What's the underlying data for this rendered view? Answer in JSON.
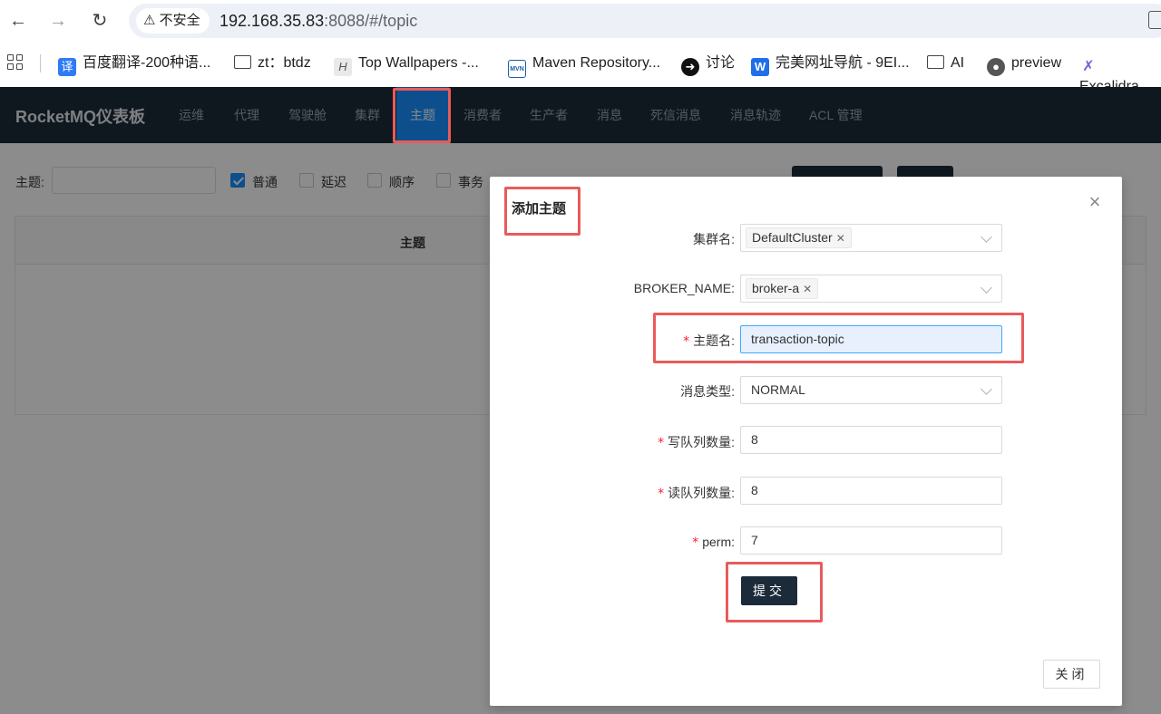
{
  "browser": {
    "security_label": "不安全",
    "url_host": "192.168.35.83",
    "url_rest": ":8088/#/topic",
    "bookmarks": [
      {
        "label": "百度翻译-200种语...",
        "icon": "translate-icon"
      },
      {
        "label": "zt：btdz",
        "icon": "folder-icon"
      },
      {
        "label": "Top Wallpapers -...",
        "icon": "wallpaper-icon"
      },
      {
        "label": "Maven Repository...",
        "icon": "maven-icon"
      },
      {
        "label": "讨论",
        "icon": "discussion-icon"
      },
      {
        "label": "完美网址导航 - 9EI...",
        "icon": "w-icon"
      },
      {
        "label": "AI",
        "icon": "folder-icon"
      },
      {
        "label": "preview",
        "icon": "globe-icon"
      },
      {
        "label": "Excalidra",
        "icon": "excalidraw-icon"
      }
    ]
  },
  "app": {
    "brand": "RocketMQ仪表板",
    "menu": [
      "运维",
      "代理",
      "驾驶舱",
      "集群",
      "主题",
      "消费者",
      "生产者",
      "消息",
      "死信消息",
      "消息轨迹",
      "ACL 管理"
    ],
    "active_menu": "主题"
  },
  "toolbar": {
    "topic_label": "主题:",
    "filters": [
      {
        "label": "普通",
        "checked": true
      },
      {
        "label": "延迟",
        "checked": false
      },
      {
        "label": "顺序",
        "checked": false
      },
      {
        "label": "事务",
        "checked": false
      }
    ]
  },
  "table": {
    "header_topic": "主题"
  },
  "modal": {
    "title": "添加主题",
    "cluster_label": "集群名:",
    "cluster_value": "DefaultCluster",
    "broker_label": "BROKER_NAME:",
    "broker_value": "broker-a",
    "topic_name_label": "主题名:",
    "topic_name_value": "transaction-topic",
    "message_type_label": "消息类型:",
    "message_type_value": "NORMAL",
    "write_queue_label": "写队列数量:",
    "write_queue_value": "8",
    "read_queue_label": "读队列数量:",
    "read_queue_value": "8",
    "perm_label": "perm:",
    "perm_value": "7",
    "submit_label": "提交",
    "close_label": "关闭"
  },
  "colors": {
    "header_bg": "#1c2b3a",
    "active_tab": "#1890ff",
    "highlight": "#e85b5b",
    "required": "#f5222d"
  }
}
